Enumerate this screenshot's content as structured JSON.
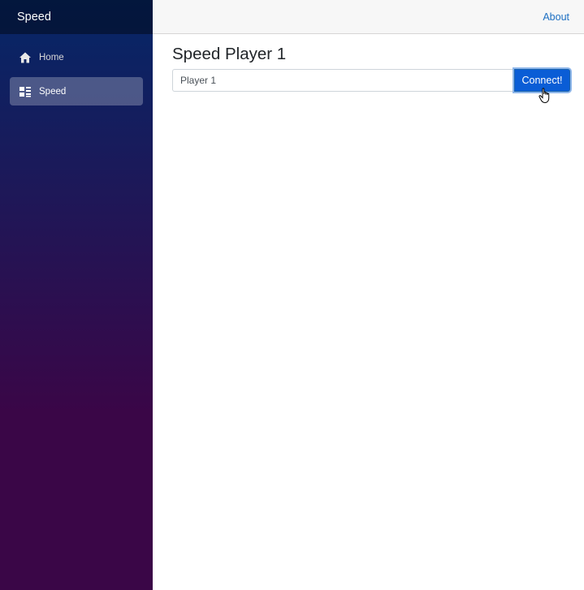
{
  "sidebar": {
    "brand": "Speed",
    "items": [
      {
        "label": "Home",
        "icon": "home-icon",
        "active": false
      },
      {
        "label": "Speed",
        "icon": "dashboard-icon",
        "active": true
      }
    ]
  },
  "header": {
    "about_label": "About"
  },
  "main": {
    "title": "Speed Player 1",
    "player_input": {
      "value": "Player 1",
      "placeholder": ""
    },
    "connect_label": "Connect!"
  },
  "colors": {
    "sidebar_gradient_top": "#052767",
    "sidebar_gradient_bottom": "#3a0647",
    "accent": "#1b6ec2",
    "button": "#0a5dd6"
  }
}
